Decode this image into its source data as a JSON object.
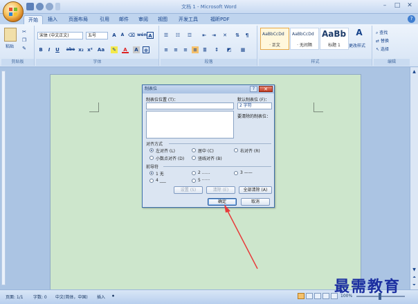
{
  "window": {
    "title": "文档 1 - Microsoft Word",
    "minimize": "–",
    "maximize": "□",
    "close": "✕"
  },
  "tabs": [
    "开始",
    "插入",
    "页面布局",
    "引用",
    "邮件",
    "审阅",
    "视图",
    "开发工具",
    "福昕PDF"
  ],
  "ribbon": {
    "clipboard": {
      "label": "剪贴板",
      "paste": "粘贴"
    },
    "font": {
      "label": "字体",
      "font_name": "宋体 (中文正文)",
      "font_size": "五号",
      "bold": "B",
      "italic": "I",
      "underline": "U",
      "strike": "abe",
      "sub": "x₂",
      "sup": "x²",
      "aa": "Aa",
      "grow": "A",
      "shrink": "A",
      "wen": "wén",
      "char_border": "A"
    },
    "paragraph": {
      "label": "段落"
    },
    "styles": {
      "label": "样式",
      "items": [
        {
          "sample": "AaBbCcDd",
          "name": "· 正文"
        },
        {
          "sample": "AaBbCcDd",
          "name": "· 无间隔"
        },
        {
          "sample": "AaBb",
          "name": "标题 1"
        }
      ],
      "change": "更改样式"
    },
    "editing": {
      "label": "编辑",
      "find": "查找",
      "replace": "替换",
      "select": "选择"
    }
  },
  "dialog": {
    "title": "制表位",
    "help": "?",
    "close": "✕",
    "tab_stop_label": "制表位位置 (T)：",
    "default_tab_label": "默认制表位 (F)：",
    "default_tab_value": "2 字符",
    "clear_label": "要清除的制表位：",
    "alignment_label": "对齐方式",
    "alignment": [
      "左对齐 (L)",
      "居中 (C)",
      "右对齐 (R)",
      "小数点对齐 (D)",
      "竖线对齐 (B)"
    ],
    "leader_label": "前导符",
    "leaders": [
      "1 无",
      "2 ……",
      "3 ——",
      "4 ___",
      "5 ······"
    ],
    "set_button": "设置 (S)",
    "clear_button": "清除 (E)",
    "clear_all_button": "全部清除 (A)",
    "ok_button": "确定",
    "cancel_button": "取消"
  },
  "statusbar": {
    "page": "页面: 1/1",
    "words": "字数: 0",
    "language": "中文(简体，中国)",
    "insert": "插入",
    "zoom": "100%"
  },
  "watermark": "最需教育",
  "colors": {
    "page_bg": "#cde6cc",
    "arrow": "#e83a3a",
    "dialog_title": "#a9c2e4"
  }
}
